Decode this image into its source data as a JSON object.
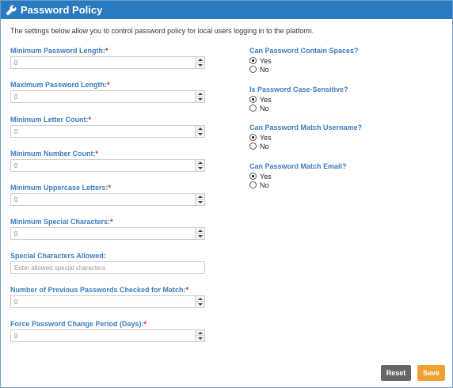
{
  "header": {
    "title": "Password Policy",
    "icon": "wrench-icon",
    "color": "#2a7ac0"
  },
  "intro": "The settings below allow you to control password policy for local users logging in to the platform.",
  "fields": [
    {
      "label": "Minimum Password Length:",
      "required": "*",
      "value": "0"
    },
    {
      "label": "Maximum Password Length:",
      "required": "*",
      "value": "0"
    },
    {
      "label": "Minimum Letter Count:",
      "required": "*",
      "value": "0"
    },
    {
      "label": "Minimum Number Count:",
      "required": "*",
      "value": "0"
    },
    {
      "label": "Minimum Uppercase Letters:",
      "required": "*",
      "value": "0"
    },
    {
      "label": "Minimum Special Characters:",
      "required": "*",
      "value": "0"
    },
    {
      "label": "Special Characters Allowed:",
      "placeholder": "Enter allowed special characters"
    },
    {
      "label": "Number of Previous Passwords Checked for Match:",
      "required": "*",
      "value": "0"
    },
    {
      "label": "Force Password Change Period (Days):",
      "required": "*",
      "value": "0"
    }
  ],
  "radios": [
    {
      "question": "Can Password Contain Spaces?",
      "options": [
        "Yes",
        "No"
      ],
      "selected": "Yes"
    },
    {
      "question": "Is Password Case-Sensitive?",
      "options": [
        "Yes",
        "No"
      ],
      "selected": "Yes"
    },
    {
      "question": "Can Password Match Username?",
      "options": [
        "Yes",
        "No"
      ],
      "selected": "Yes"
    },
    {
      "question": "Can Password Match Email?",
      "options": [
        "Yes",
        "No"
      ],
      "selected": "Yes"
    }
  ],
  "buttons": {
    "reset": "Reset",
    "save": "Save"
  },
  "colors": {
    "label": "#3a7ec0",
    "required": "#d9212b",
    "reset": "#666666",
    "save": "#f0a032"
  }
}
